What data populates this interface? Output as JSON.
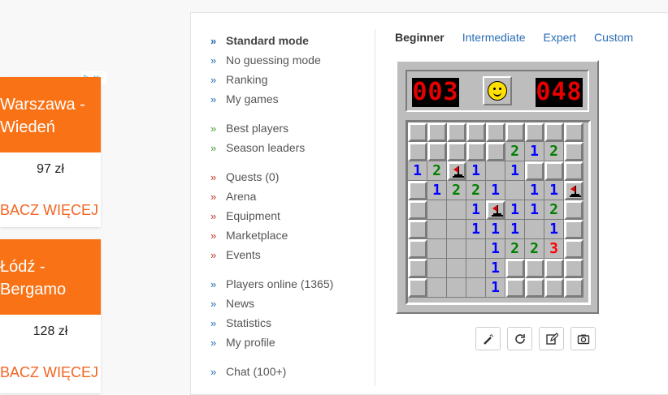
{
  "ads": [
    {
      "route_line1": "Warszawa -",
      "route_line2": "Wiedeń",
      "price": "97 zł",
      "cta": "BACZ WIĘCEJ"
    },
    {
      "route_line1": "Łódź -",
      "route_line2": "Bergamo",
      "price": "128 zł",
      "cta": "BACZ WIĘCEJ"
    }
  ],
  "adchoices": {
    "symbol": "▷",
    "close": "x"
  },
  "menu": {
    "group1": [
      "Standard mode",
      "No guessing mode",
      "Ranking",
      "My games"
    ],
    "group2": [
      "Best players",
      "Season leaders"
    ],
    "group3": [
      "Quests (0)",
      "Arena",
      "Equipment",
      "Marketplace",
      "Events"
    ],
    "group4": [
      "Players online (1365)",
      "News",
      "Statistics",
      "My profile"
    ],
    "group5": [
      "Chat (100+)"
    ]
  },
  "tabs": [
    "Beginner",
    "Intermediate",
    "Expert",
    "Custom"
  ],
  "game": {
    "mines_counter": "003",
    "timer": "048",
    "face": "smiley",
    "board": [
      "#########",
      "#####212#",
      "12F1 1###",
      "#1221 11F",
      "#  1F112#",
      "#  111 1#",
      "#   1223#",
      "#   1####",
      "#   1####"
    ]
  },
  "tools": [
    "wand-icon",
    "restart-icon",
    "edit-icon",
    "camera-icon"
  ]
}
